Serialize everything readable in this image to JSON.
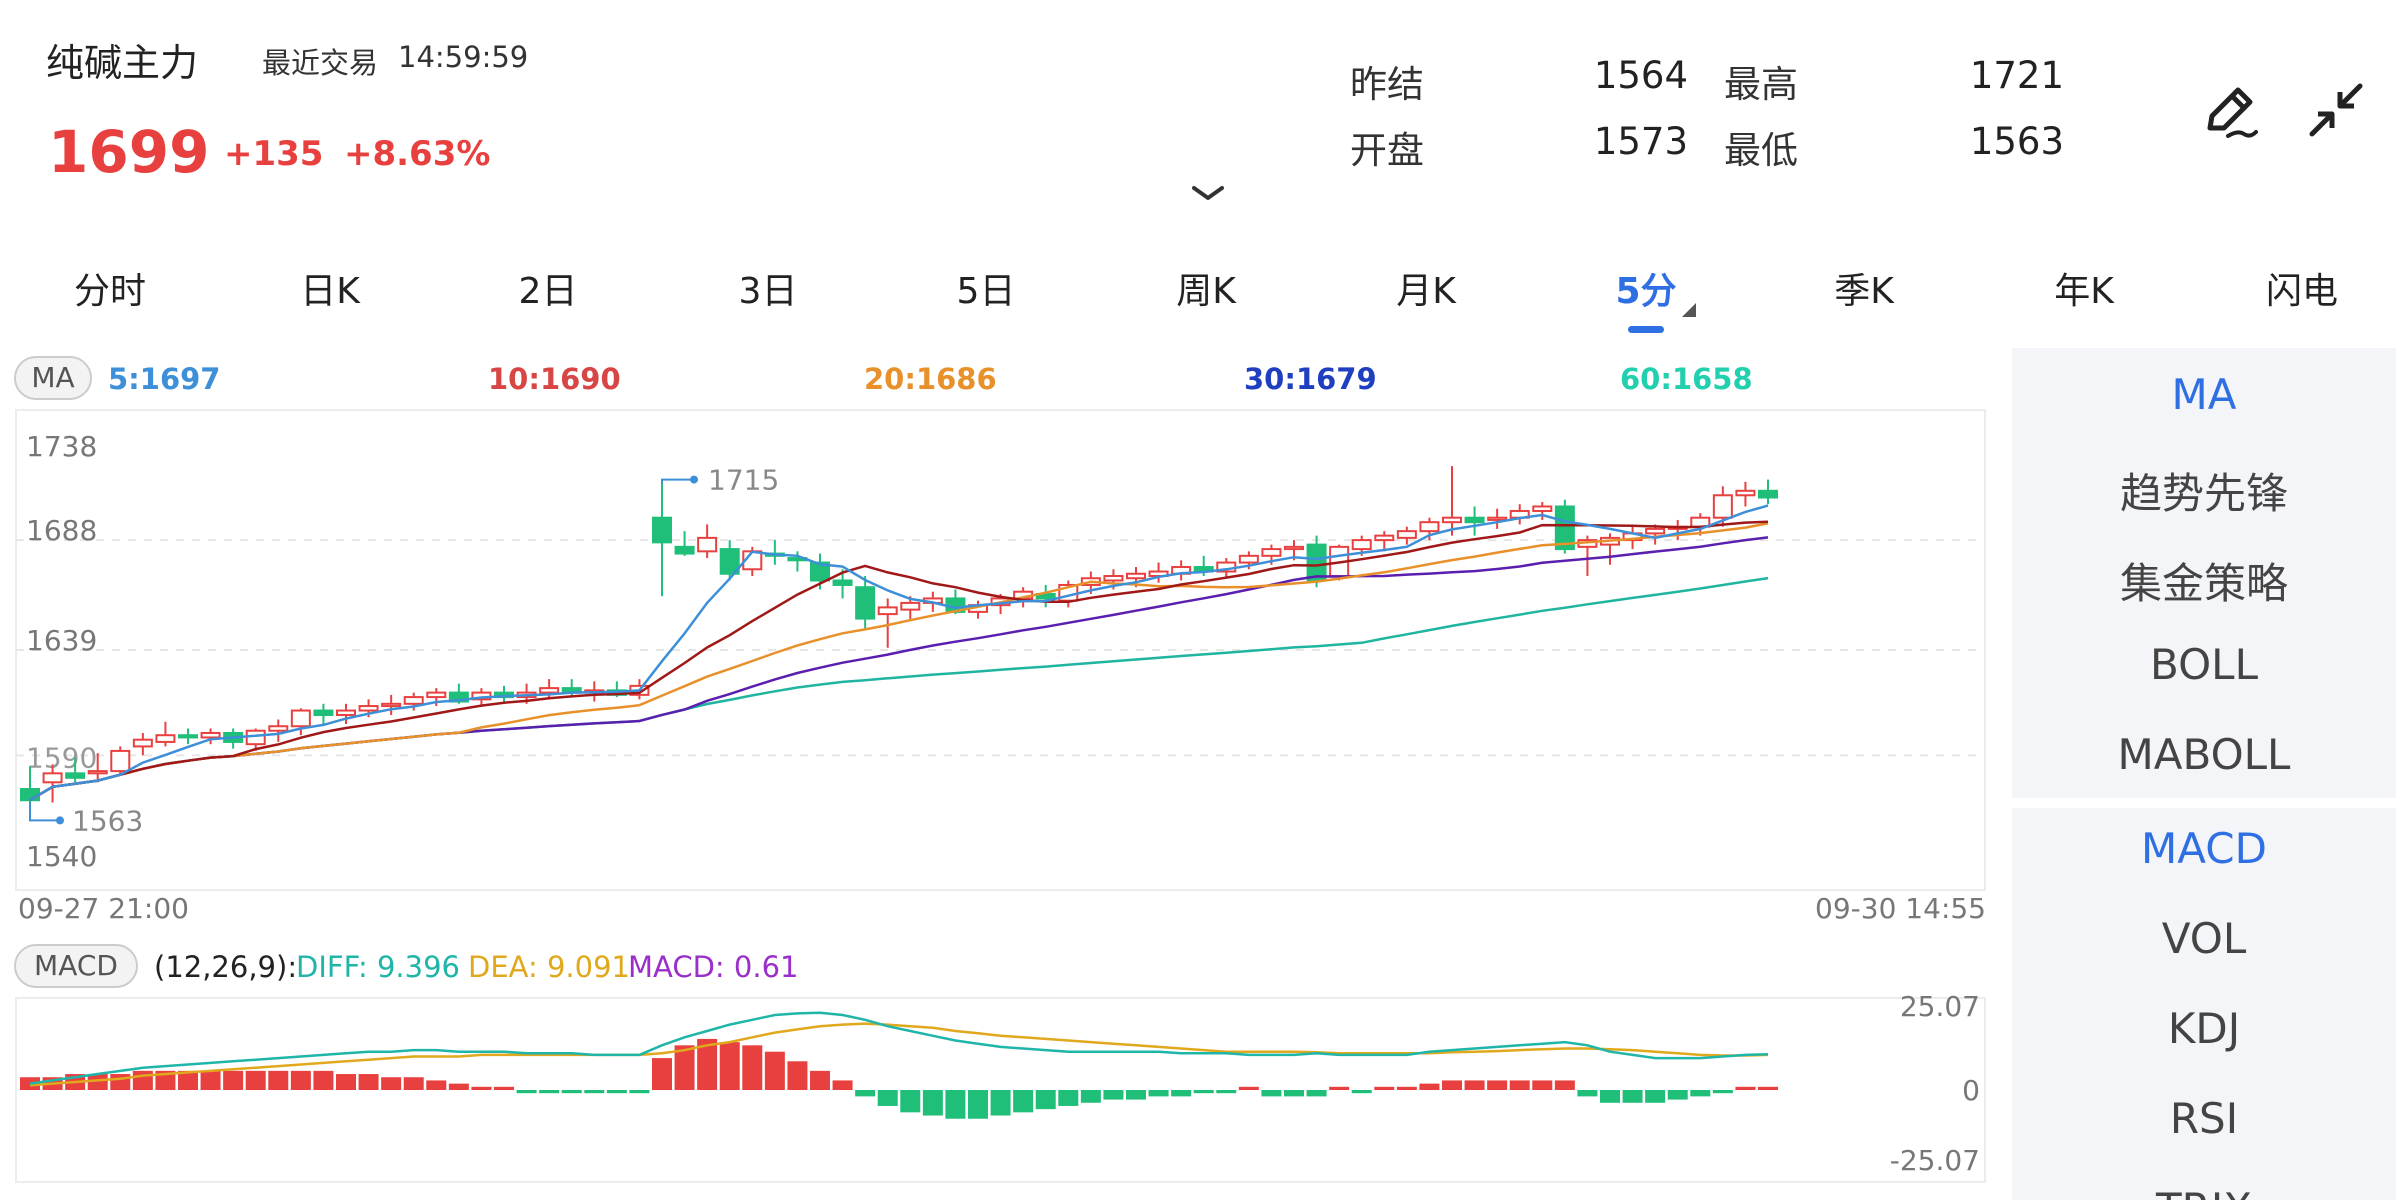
{
  "header": {
    "title": "纯碱主力",
    "last_trade_label": "最近交易",
    "last_trade_time": "14:59:59",
    "price": "1699",
    "change": "+135",
    "change_pct": "+8.63%",
    "stats": {
      "prev_settle_label": "昨结",
      "prev_settle": "1564",
      "high_label": "最高",
      "high": "1721",
      "open_label": "开盘",
      "open": "1573",
      "low_label": "最低",
      "low": "1563"
    }
  },
  "tabs": [
    {
      "label": "分时"
    },
    {
      "label": "日K"
    },
    {
      "label": "2日"
    },
    {
      "label": "3日"
    },
    {
      "label": "5日"
    },
    {
      "label": "周K"
    },
    {
      "label": "月K"
    },
    {
      "label": "5分"
    },
    {
      "label": "季K"
    },
    {
      "label": "年K"
    },
    {
      "label": "闪电"
    }
  ],
  "active_tab": "5分",
  "side_panel": {
    "main_indicators": [
      "MA",
      "趋势先锋",
      "集金策略",
      "BOLL",
      "MABOLL"
    ],
    "sub_indicators": [
      "MACD",
      "VOL",
      "KDJ",
      "RSI",
      "TRIX"
    ],
    "active_main": "MA",
    "active_sub": "MACD"
  },
  "ma_legend": {
    "label": "MA",
    "items": [
      {
        "text": "5:1697",
        "color": "#3d8fd8"
      },
      {
        "text": "10:1690",
        "color": "#d84545"
      },
      {
        "text": "20:1686",
        "color": "#e8902a"
      },
      {
        "text": "30:1679",
        "color": "#1f3fc0"
      },
      {
        "text": "60:1658",
        "color": "#22d0b0"
      }
    ]
  },
  "macd_legend": {
    "label": "MACD",
    "params": "(12,26,9):",
    "diff": "DIFF: 9.396",
    "dea": "DEA: 9.091",
    "macd": "MACD: 0.61",
    "diff_color": "#1fb5a8",
    "dea_color": "#e0a81c",
    "macd_color": "#9a2fc9"
  },
  "colors": {
    "up": "#e8403f",
    "down": "#1fbf79",
    "accent": "#2f6fe4",
    "ma5": "#3d8fd8",
    "ma10": "#a01818",
    "ma20": "#e8902a",
    "ma30": "#5b1fb0",
    "ma60": "#1fb5a0"
  },
  "chart_data": [
    {
      "type": "candlestick",
      "title": "",
      "y_ticks": [
        "1738",
        "1688",
        "1639",
        "1540"
      ],
      "ylim": [
        1540,
        1738
      ],
      "x_start_label": "09-27 21:00",
      "x_end_label": "09-30 14:55",
      "high_marker": "1715",
      "low_marker": "1563",
      "partial_tick_label": "1590",
      "candles_ohlc_approx": [
        [
          1577,
          1587,
          1570,
          1572
        ],
        [
          1580,
          1588,
          1571,
          1584
        ],
        [
          1584,
          1591,
          1580,
          1582
        ],
        [
          1584,
          1593,
          1580,
          1585
        ],
        [
          1585,
          1596,
          1583,
          1594
        ],
        [
          1596,
          1602,
          1592,
          1599
        ],
        [
          1598,
          1607,
          1596,
          1601
        ],
        [
          1601,
          1604,
          1597,
          1600
        ],
        [
          1600,
          1604,
          1597,
          1602
        ],
        [
          1602,
          1604,
          1595,
          1598
        ],
        [
          1597,
          1604,
          1594,
          1603
        ],
        [
          1603,
          1608,
          1598,
          1605
        ],
        [
          1605,
          1613,
          1601,
          1612
        ],
        [
          1612,
          1615,
          1606,
          1610
        ],
        [
          1610,
          1615,
          1606,
          1612
        ],
        [
          1612,
          1617,
          1609,
          1614
        ],
        [
          1614,
          1619,
          1610,
          1615
        ],
        [
          1615,
          1620,
          1612,
          1618
        ],
        [
          1618,
          1622,
          1614,
          1620
        ],
        [
          1620,
          1624,
          1615,
          1616
        ],
        [
          1617,
          1622,
          1614,
          1620
        ],
        [
          1620,
          1623,
          1616,
          1618
        ],
        [
          1618,
          1624,
          1615,
          1620
        ],
        [
          1620,
          1626,
          1617,
          1622
        ],
        [
          1622,
          1626,
          1618,
          1620
        ],
        [
          1620,
          1625,
          1616,
          1621
        ],
        [
          1621,
          1625,
          1618,
          1619
        ],
        [
          1619,
          1626,
          1617,
          1623
        ],
        [
          1698,
          1715,
          1663,
          1687
        ],
        [
          1685,
          1692,
          1681,
          1682
        ],
        [
          1683,
          1695,
          1680,
          1689
        ],
        [
          1684,
          1688,
          1670,
          1673
        ],
        [
          1675,
          1685,
          1672,
          1683
        ],
        [
          1682,
          1688,
          1677,
          1681
        ],
        [
          1680,
          1683,
          1674,
          1679
        ],
        [
          1678,
          1682,
          1666,
          1670
        ],
        [
          1670,
          1675,
          1662,
          1668
        ],
        [
          1667,
          1672,
          1648,
          1653
        ],
        [
          1655,
          1662,
          1640,
          1658
        ],
        [
          1657,
          1663,
          1652,
          1660
        ],
        [
          1660,
          1665,
          1656,
          1662
        ],
        [
          1662,
          1666,
          1655,
          1656
        ],
        [
          1656,
          1661,
          1653,
          1659
        ],
        [
          1659,
          1664,
          1655,
          1662
        ],
        [
          1662,
          1667,
          1658,
          1665
        ],
        [
          1664,
          1668,
          1658,
          1662
        ],
        [
          1661,
          1670,
          1658,
          1668
        ],
        [
          1668,
          1674,
          1664,
          1671
        ],
        [
          1670,
          1675,
          1666,
          1672
        ],
        [
          1671,
          1676,
          1667,
          1673
        ],
        [
          1672,
          1678,
          1669,
          1674
        ],
        [
          1673,
          1679,
          1670,
          1676
        ],
        [
          1676,
          1681,
          1672,
          1674
        ],
        [
          1674,
          1680,
          1671,
          1678
        ],
        [
          1678,
          1683,
          1675,
          1681
        ],
        [
          1681,
          1686,
          1677,
          1684
        ],
        [
          1684,
          1688,
          1679,
          1685
        ],
        [
          1686,
          1690,
          1667,
          1670
        ],
        [
          1672,
          1686,
          1670,
          1685
        ],
        [
          1684,
          1690,
          1681,
          1688
        ],
        [
          1688,
          1692,
          1683,
          1690
        ],
        [
          1689,
          1694,
          1686,
          1692
        ],
        [
          1692,
          1698,
          1688,
          1696
        ],
        [
          1696,
          1721,
          1690,
          1698
        ],
        [
          1698,
          1703,
          1690,
          1696
        ],
        [
          1697,
          1702,
          1693,
          1698
        ],
        [
          1698,
          1704,
          1695,
          1701
        ],
        [
          1701,
          1705,
          1697,
          1703
        ],
        [
          1703,
          1706,
          1682,
          1684
        ],
        [
          1685,
          1690,
          1672,
          1688
        ],
        [
          1686,
          1691,
          1677,
          1689
        ],
        [
          1688,
          1694,
          1684,
          1691
        ],
        [
          1691,
          1695,
          1686,
          1693
        ],
        [
          1693,
          1697,
          1688,
          1694
        ],
        [
          1694,
          1700,
          1690,
          1698
        ],
        [
          1698,
          1712,
          1694,
          1708
        ],
        [
          1708,
          1714,
          1703,
          1710
        ],
        [
          1710,
          1715,
          1704,
          1707
        ]
      ]
    },
    {
      "type": "bar",
      "title": "",
      "y_ticks": [
        "25.07",
        "0",
        "-25.07"
      ],
      "ylim": [
        -25.07,
        25.07
      ],
      "series": [
        {
          "name": "DIFF",
          "values": [
            2,
            3,
            4,
            5,
            6,
            7,
            7.5,
            8,
            8.5,
            9,
            9.5,
            10,
            10.5,
            11,
            11.5,
            12,
            12,
            12.5,
            12.5,
            12,
            12,
            12,
            11.5,
            11.5,
            11.5,
            11,
            11,
            11,
            14,
            16.5,
            18.5,
            20.5,
            22,
            23.5,
            24,
            24.2,
            23.5,
            22,
            20,
            18.5,
            17,
            15.5,
            14.5,
            13.5,
            13,
            12.5,
            12,
            12,
            12,
            12,
            12,
            11.5,
            11.5,
            11.5,
            11,
            11,
            11,
            11.5,
            11,
            11,
            11,
            11,
            12,
            12.5,
            13,
            13.5,
            14,
            14.5,
            15,
            14,
            12,
            11,
            10,
            10,
            10,
            10.5,
            11,
            11.2
          ]
        },
        {
          "name": "DEA",
          "values": [
            1.5,
            2,
            2.5,
            3,
            3.5,
            4.5,
            5,
            5.5,
            6,
            6.5,
            7,
            7.5,
            8,
            8.5,
            9,
            9.5,
            10,
            10.5,
            10.5,
            10.5,
            11,
            11,
            11,
            11,
            11,
            11,
            11,
            11,
            11.5,
            12.5,
            14,
            15,
            16.5,
            18,
            19,
            20,
            20.5,
            20.8,
            20.5,
            20,
            19.5,
            18.5,
            17.8,
            17,
            16.5,
            16,
            15.5,
            15,
            14.5,
            14,
            13.5,
            13,
            12.5,
            12,
            12,
            12,
            12,
            11.8,
            11.5,
            11.5,
            11.5,
            11.5,
            11.5,
            11.8,
            12,
            12.2,
            12.5,
            12.8,
            13,
            13,
            12.8,
            12.5,
            12,
            11.5,
            11,
            10.8,
            10.8,
            11
          ]
        },
        {
          "name": "MACD",
          "values": [
            4,
            4,
            5,
            5,
            5,
            6,
            6,
            6,
            6,
            6,
            6,
            6,
            6,
            6,
            5,
            5,
            4,
            4,
            3,
            2,
            1,
            1,
            -1,
            -1,
            -1,
            -1,
            -1,
            -1,
            10,
            14,
            16,
            15,
            14,
            12,
            9,
            6,
            3,
            -2,
            -5,
            -7,
            -8,
            -9,
            -9,
            -8,
            -7,
            -6,
            -5,
            -4,
            -3,
            -3,
            -2,
            -2,
            -1,
            -1,
            1,
            -2,
            -2,
            -2,
            1,
            -1,
            1,
            1,
            2,
            3,
            3,
            3,
            3,
            3,
            3,
            -2,
            -4,
            -4,
            -4,
            -3,
            -2,
            -1,
            1,
            1
          ]
        }
      ]
    }
  ]
}
